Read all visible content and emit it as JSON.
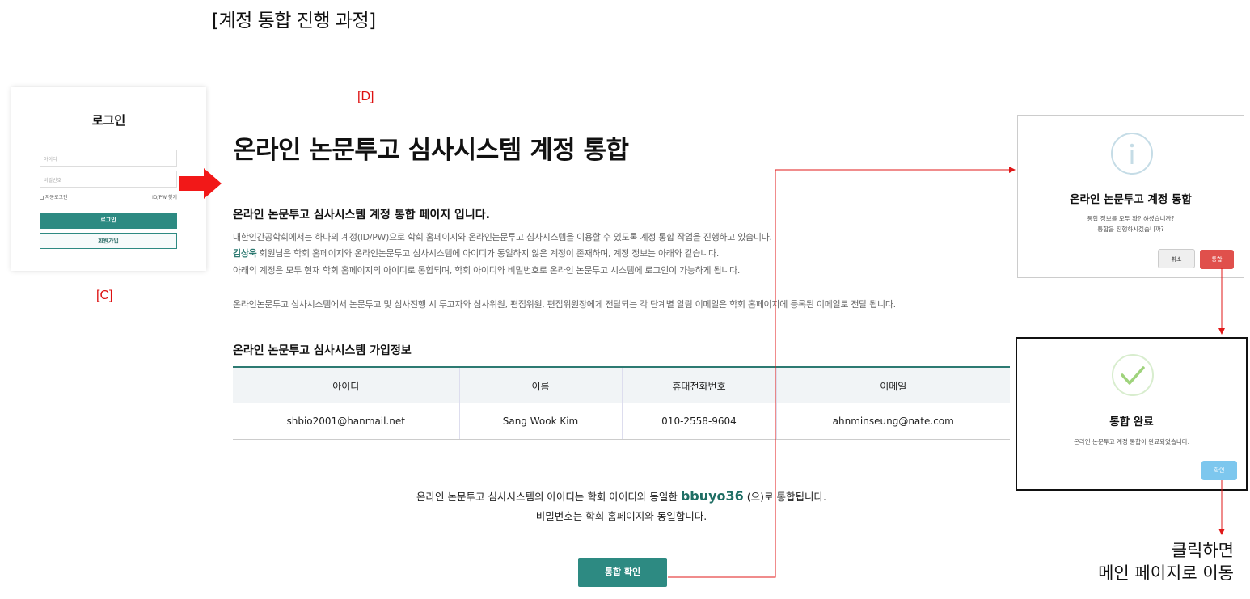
{
  "heading": "[계정 통합 진행 과정]",
  "markers": {
    "c": "[C]",
    "d": "[D]"
  },
  "login": {
    "title": "로그인",
    "id_placeholder": "아이디",
    "pw_placeholder": "비밀번호",
    "auto_login": "자동로그인",
    "find": "ID/PW 찾기",
    "login_button": "로그인",
    "signup_button": "회원가입"
  },
  "page": {
    "title": "온라인 논문투고 심사시스템 계정 통합",
    "intro_title": "온라인 논문투고 심사시스템 계정 통합 페이지 입니다.",
    "desc_line1": "대한인간공학회에서는 하나의 계정(ID/PW)으로 학회 홈페이지와 온라인논문투고 심사시스템을 이용할 수 있도록 계정 통합 작업을 진행하고 있습니다.",
    "member_name": "김상욱",
    "desc_line2": " 회원님은 학회 홈페이지와 온라인논문투고 심사시스템에 아이디가 동일하지 않은 계정이 존재하며, 계정 정보는 아래와 같습니다.",
    "desc_line3": "아래의 계정은 모두 현재 학회 홈페이지의 아이디로 통합되며, 학회 아이디와 비밀번호로 온라인 논문투고 시스템에 로그인이 가능하게 됩니다.",
    "desc_line4": "온라인논문투고 심사시스템에서 논문투고 및 심사진행 시 투고자와 심사위원, 편집위원, 편집위원장에게 전달되는 각 단계별 알림 이메일은 학회 홈페이지에 등록된 이메일로 전달 됩니다.",
    "info_title": "온라인 논문투고 심사시스템 가입정보",
    "table": {
      "headers": [
        "아이디",
        "이름",
        "휴대전화번호",
        "이메일"
      ],
      "row": [
        "shbio2001@hanmail.net",
        "Sang Wook Kim",
        "010-2558-9604",
        "ahnminseung@nate.com"
      ]
    },
    "merge_prefix": "온라인 논문투고 심사시스템의 아이디는 학회 아이디와 동일한 ",
    "merge_id": "bbuyo36",
    "merge_suffix": " (으)로 통합됩니다.",
    "password_note": "비밀번호는 학회 홈페이지와 동일합니다.",
    "confirm_button": "통합 확인"
  },
  "dialog_confirm": {
    "title": "온라인 논문투고 계정 통합",
    "line1": "통합 정보를 모두 확인하셨습니까?",
    "line2": "통합을 진행하시겠습니까?",
    "cancel": "취소",
    "merge": "통합"
  },
  "dialog_done": {
    "title": "통합 완료",
    "text": "온라인 논문투고 계정 통합이 완료되었습니다.",
    "ok": "확인"
  },
  "note": {
    "line1": "클릭하면",
    "line2": "메인 페이지로 이동"
  },
  "colors": {
    "accent": "#2d8a82",
    "danger": "#e0504c",
    "arrow": "#e01818",
    "ok": "#7dc7ee"
  }
}
